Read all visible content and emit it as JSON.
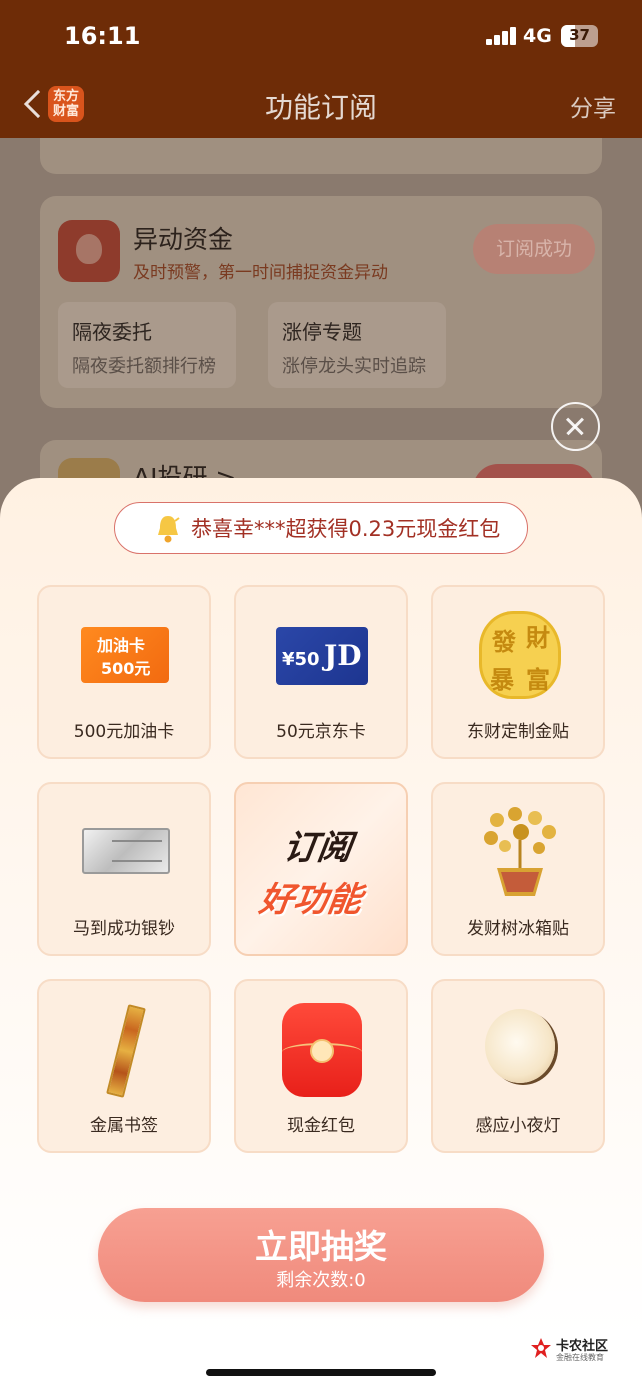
{
  "status_bar": {
    "time": "16:11",
    "network": "4G",
    "battery": "37"
  },
  "nav": {
    "title": "功能订阅",
    "share": "分享",
    "logo_text": "东方财富"
  },
  "background": {
    "fund_card": {
      "title": "异动资金",
      "desc": "及时预警，第一时间捕捉资金异动",
      "button": "订阅成功",
      "tiles": [
        {
          "title": "隔夜委托",
          "desc": "隔夜委托额排行榜"
        },
        {
          "title": "涨停专题",
          "desc": "涨停龙头实时追踪"
        }
      ]
    },
    "ai_card": {
      "title": "AI投研 >"
    }
  },
  "ticker": {
    "text": "恭喜幸***超获得0.23元现金红包"
  },
  "prizes": [
    {
      "label": "500元加油卡",
      "icon": "fuel-card-icon",
      "card_title": "加油卡",
      "card_value": "500元"
    },
    {
      "label": "50元京东卡",
      "icon": "jd-card-icon",
      "card_value": "¥50",
      "card_brand": "JD"
    },
    {
      "label": "东财定制金贴",
      "icon": "gold-sticker-icon",
      "chars": [
        "發",
        "財",
        "暴",
        "富"
      ]
    },
    {
      "label": "马到成功银钞",
      "icon": "silver-note-icon"
    },
    {
      "label": "订阅",
      "label2": "好功能",
      "icon": "subscribe-badge"
    },
    {
      "label": "发财树冰箱贴",
      "icon": "money-tree-icon"
    },
    {
      "label": "金属书签",
      "icon": "bookmark-icon"
    },
    {
      "label": "现金红包",
      "icon": "red-envelope-icon"
    },
    {
      "label": "感应小夜灯",
      "icon": "night-light-icon"
    }
  ],
  "draw_button": {
    "label": "立即抽奖",
    "remaining": "剩余次数:0"
  },
  "watermark": {
    "title": "卡农社区",
    "subtitle": "金融在线教育"
  },
  "colors": {
    "accent": "#f08a7c",
    "nav_bg": "#6e2c07",
    "ticker_text": "#a23024"
  }
}
